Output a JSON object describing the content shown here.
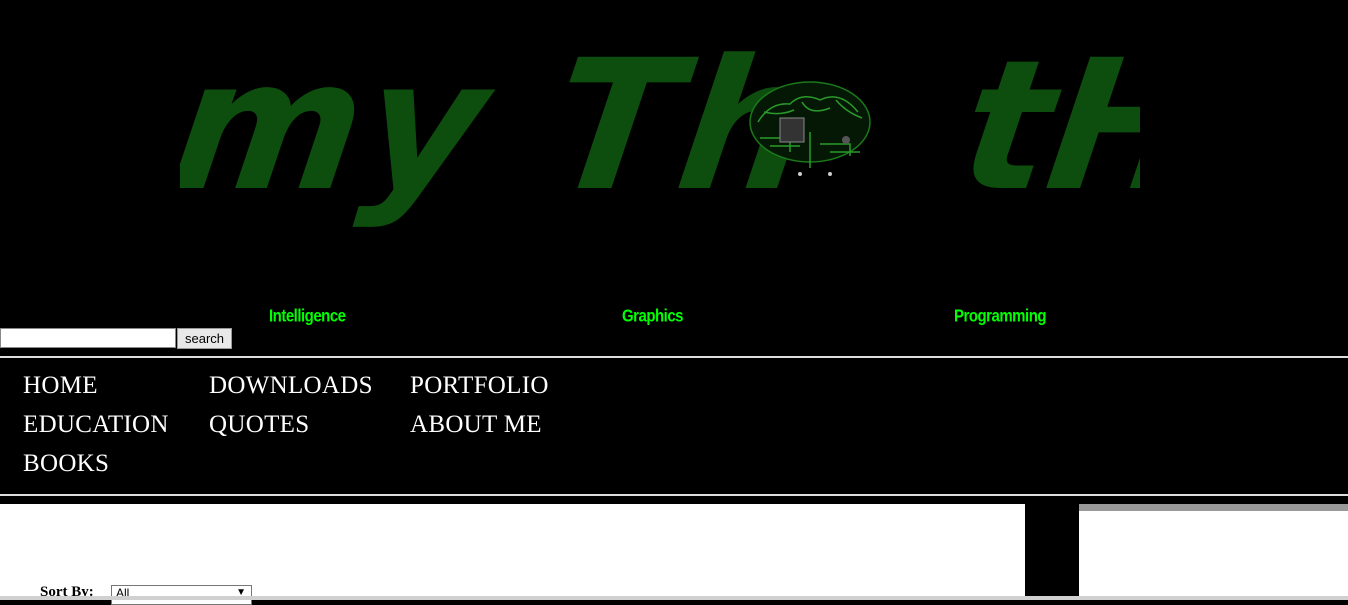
{
  "logo": {
    "text_left": "my Th",
    "text_right": "tH",
    "color": "#0d4d0d",
    "brain_icon": "circuit-brain-icon"
  },
  "taglines": [
    "Intelligence",
    "Graphics",
    "Programming"
  ],
  "tagline_color": "#00ff00",
  "search": {
    "value": "",
    "button_label": "search"
  },
  "nav": {
    "items": [
      "HOME",
      "DOWNLOADS",
      "PORTFOLIO",
      "EDUCATION",
      "QUOTES",
      "ABOUT ME",
      "BOOKS"
    ]
  },
  "content": {
    "sort_label": "Sort By:",
    "sort_selected": "All"
  }
}
